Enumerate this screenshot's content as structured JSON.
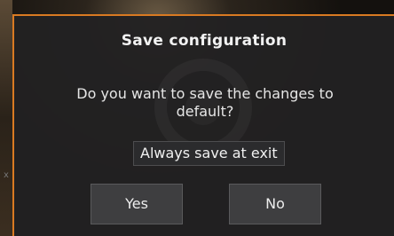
{
  "dialog": {
    "title": "Save configuration",
    "message": "Do you want to save the changes to default?",
    "always_save_label": "Always save at exit",
    "buttons": {
      "yes": "Yes",
      "no": "No"
    }
  },
  "edge_marker": "x",
  "colors": {
    "accent_border": "#d97a22",
    "dialog_bg": "#222122",
    "button_bg": "#3e3e40",
    "text": "#f2f2f2"
  },
  "icons": {
    "watermark": "gear-logo-watermark"
  }
}
